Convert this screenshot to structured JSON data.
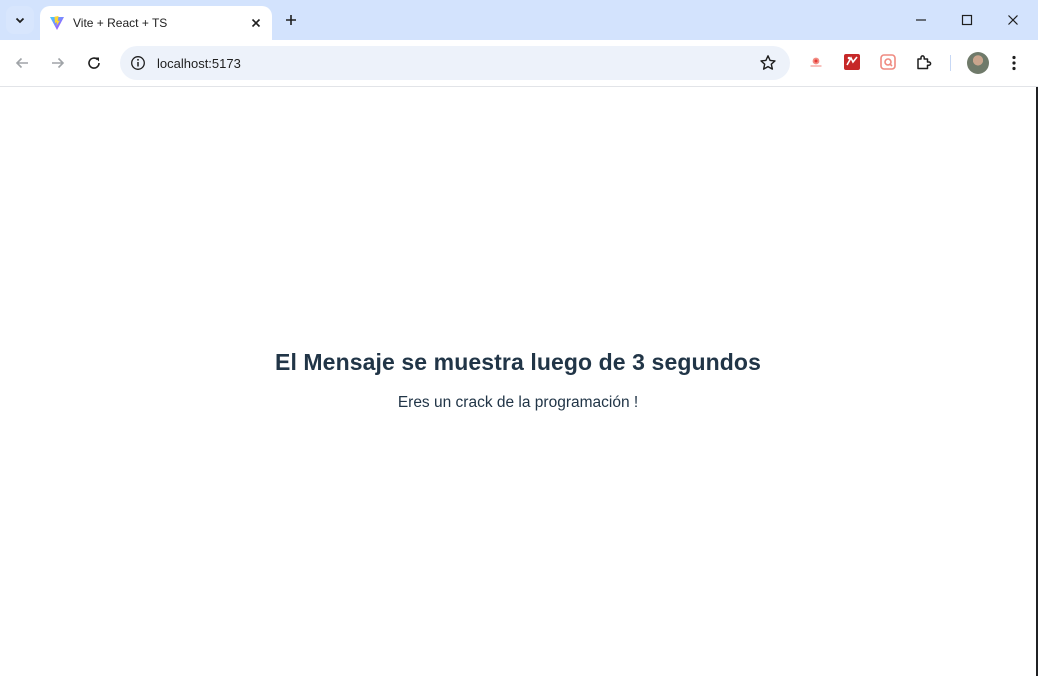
{
  "browser": {
    "tab": {
      "title": "Vite + React + TS",
      "favicon": "vite-logo-icon"
    },
    "address_bar": {
      "url": "localhost:5173"
    },
    "toolbar_icons": [
      "back-icon",
      "forward-icon",
      "reload-icon",
      "site-info-icon",
      "bookmark-star-icon",
      "extensions-icon",
      "profile-avatar",
      "menu-icon"
    ],
    "accent_color": "#d3e3fd"
  },
  "page": {
    "heading": "El Mensaje se muestra luego de 3 segundos",
    "message": "Eres un crack de la programación !",
    "text_color": "#213547"
  }
}
